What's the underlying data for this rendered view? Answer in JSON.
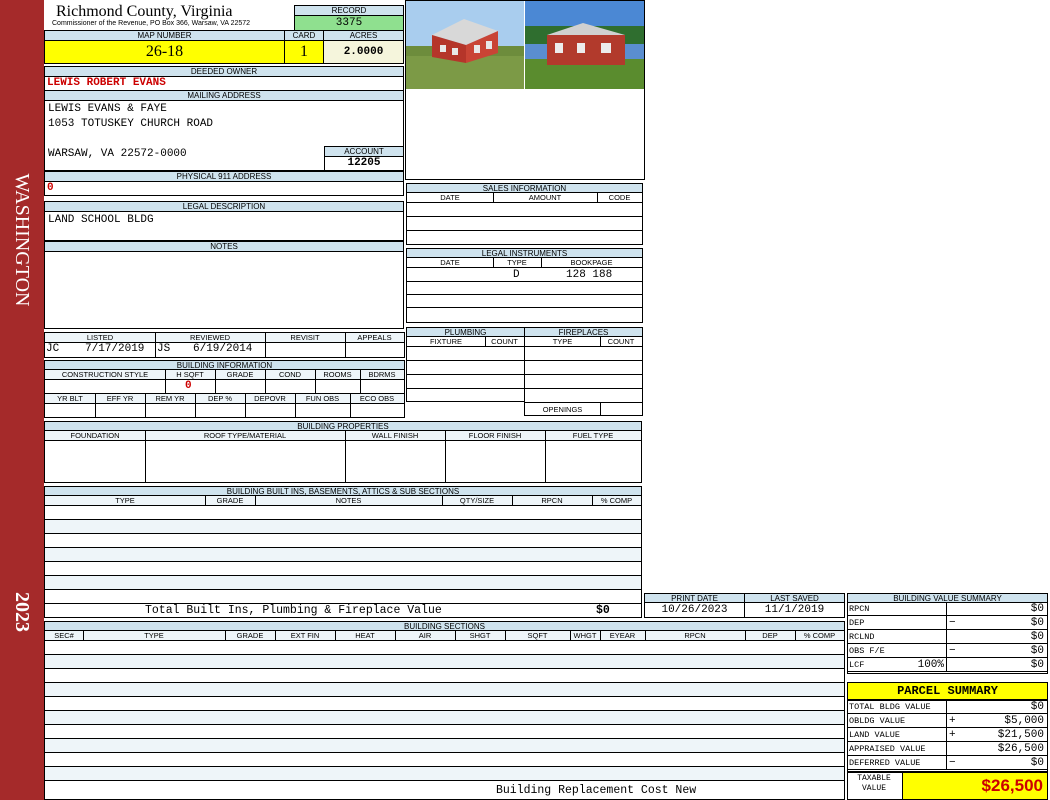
{
  "sidebar": {
    "district": "WASHINGTON",
    "year": "2023",
    "color": "#a52a2a"
  },
  "header": {
    "county": "Richmond County, Virginia",
    "commissioner": "Commissioner of the Revenue, PO Box 366, Warsaw, VA 22572",
    "record_label": "RECORD",
    "record": "3375",
    "map_number_label": "MAP NUMBER",
    "map_number": "26-18",
    "card_label": "CARD",
    "card": "1",
    "acres_label": "ACRES",
    "acres": "2.0000"
  },
  "owner": {
    "deeded_owner_label": "DEEDED OWNER",
    "deeded_owner": "LEWIS ROBERT EVANS",
    "mailing_label": "MAILING ADDRESS",
    "mail_line1": "LEWIS EVANS & FAYE",
    "mail_line2": "1053 TOTUSKEY CHURCH ROAD",
    "mail_line3": "WARSAW, VA 22572-0000",
    "account_label": "ACCOUNT",
    "account": "12205",
    "physical_label": "PHYSICAL 911 ADDRESS",
    "physical": "0",
    "legal_label": "LEGAL DESCRIPTION",
    "legal": "LAND SCHOOL BLDG",
    "notes_label": "NOTES"
  },
  "review": {
    "listed_label": "LISTED",
    "reviewed_label": "REVIEWED",
    "revisit_label": "REVISIT",
    "appeals_label": "APPEALS",
    "listed_by": "JC",
    "listed_date": "7/17/2019",
    "reviewed_by": "JS",
    "reviewed_date": "6/19/2014"
  },
  "building_info": {
    "title": "BUILDING INFORMATION",
    "cols1": [
      "CONSTRUCTION STYLE",
      "H SQFT",
      "GRADE",
      "COND",
      "ROOMS",
      "BDRMS"
    ],
    "hsqft": "0",
    "cols2": [
      "YR BLT",
      "EFF YR",
      "REM YR",
      "DEP %",
      "DEPOVR",
      "FUN OBS",
      "ECO OBS"
    ]
  },
  "sales": {
    "title": "SALES INFORMATION",
    "cols": [
      "DATE",
      "AMOUNT",
      "CODE"
    ]
  },
  "legal_instruments": {
    "title": "LEGAL INSTRUMENTS",
    "cols": [
      "DATE",
      "TYPE",
      "BOOKPAGE"
    ],
    "type": "D",
    "bookpage": "128 188"
  },
  "plumbing": {
    "title": "PLUMBING",
    "cols": [
      "FIXTURE",
      "COUNT"
    ]
  },
  "fireplaces": {
    "title": "FIREPLACES",
    "cols": [
      "TYPE",
      "COUNT"
    ],
    "openings_label": "OPENINGS"
  },
  "properties": {
    "title": "BUILDING PROPERTIES",
    "cols": [
      "FOUNDATION",
      "ROOF TYPE/MATERIAL",
      "WALL FINISH",
      "FLOOR FINISH",
      "FUEL TYPE"
    ]
  },
  "builtins": {
    "title": "BUILDING BUILT INS, BASEMENTS, ATTICS & SUB SECTIONS",
    "cols": [
      "TYPE",
      "GRADE",
      "NOTES",
      "QTY/SIZE",
      "RPCN",
      "% COMP"
    ],
    "total_label": "Total Built Ins, Plumbing & Fireplace Value",
    "total_value": "$0"
  },
  "dates": {
    "print_label": "PRINT DATE",
    "print_date": "10/26/2023",
    "saved_label": "LAST SAVED",
    "saved_date": "11/1/2019"
  },
  "sections": {
    "title": "BUILDING SECTIONS",
    "cols": [
      "SEC#",
      "TYPE",
      "GRADE",
      "EXT FIN",
      "HEAT",
      "AIR",
      "SHGT",
      "SQFT",
      "WHGT",
      "EYEAR",
      "RPCN",
      "DEP",
      "% COMP"
    ],
    "footer": "Building Replacement Cost New"
  },
  "bvs": {
    "title": "BUILDING VALUE SUMMARY",
    "rows": [
      {
        "label": "RPCN",
        "sign": "",
        "value": "$0"
      },
      {
        "label": "DEP",
        "sign": "−",
        "value": "$0"
      },
      {
        "label": "RCLND",
        "sign": "",
        "value": "$0"
      },
      {
        "label": "OBS F/E",
        "sign": "−",
        "value": "$0"
      },
      {
        "label": "LCF",
        "sign": "100%",
        "value": "$0"
      }
    ]
  },
  "parcel": {
    "title": "PARCEL SUMMARY",
    "rows": [
      {
        "label": "TOTAL BLDG VALUE",
        "sign": "",
        "value": "$0"
      },
      {
        "label": "OBLDG VALUE",
        "sign": "+",
        "value": "$5,000"
      },
      {
        "label": "LAND VALUE",
        "sign": "+",
        "value": "$21,500"
      },
      {
        "label": "APPRAISED VALUE",
        "sign": "",
        "value": "$26,500"
      },
      {
        "label": "DEFERRED VALUE",
        "sign": "−",
        "value": "$0"
      }
    ],
    "taxable_label": "TAXABLE VALUE",
    "taxable_value": "$26,500"
  }
}
